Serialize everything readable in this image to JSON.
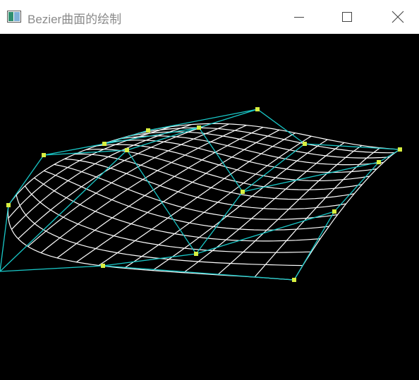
{
  "window": {
    "title": "Bezier曲面的绘制",
    "app_icon": "window-app-icon",
    "controls": {
      "minimize_icon": "minimize-icon",
      "maximize_icon": "maximize-icon",
      "close_icon": "close-icon"
    }
  },
  "canvas": {
    "background": "#000000",
    "surface_color": "#ffffff",
    "control_net_color": "#19c8c8",
    "control_point_color": "#d8f040"
  }
}
